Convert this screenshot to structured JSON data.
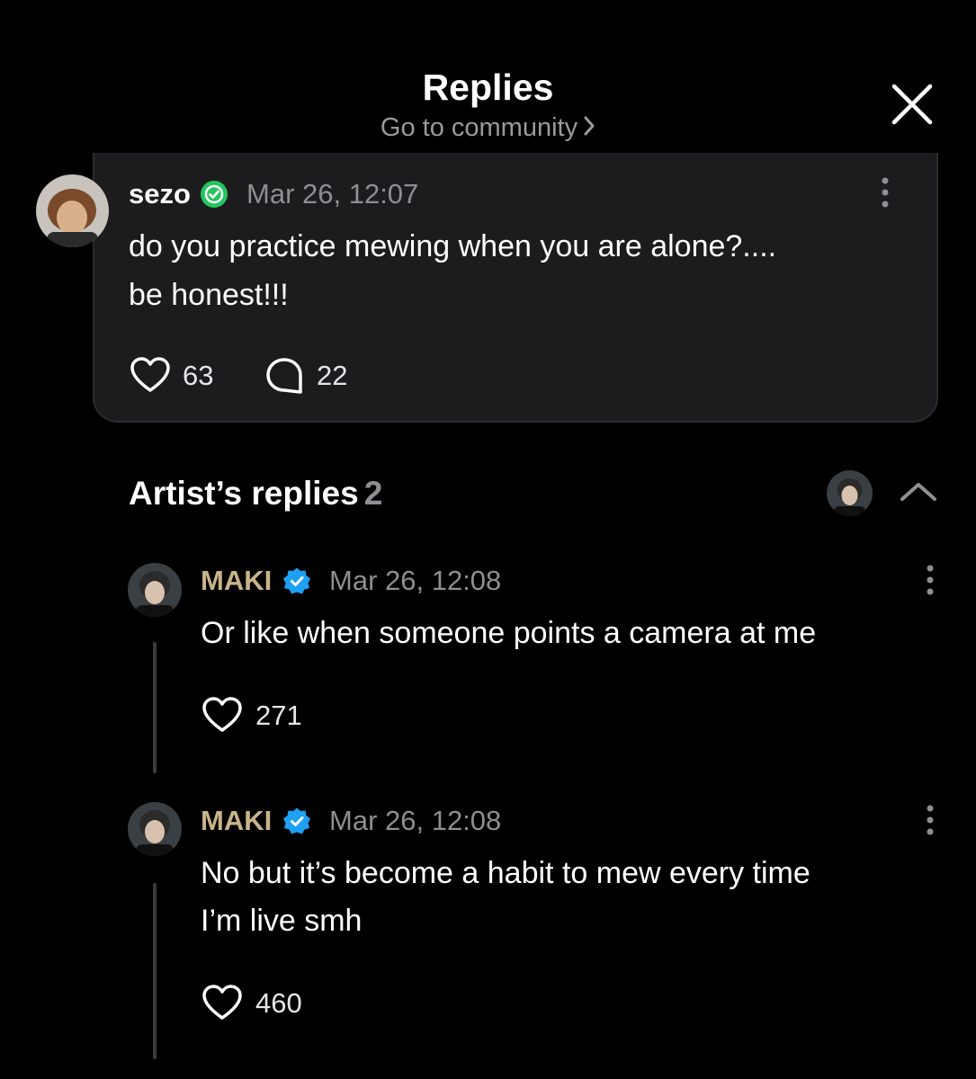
{
  "header": {
    "title": "Replies",
    "community_link": "Go to community"
  },
  "post": {
    "username": "sezo",
    "date": "Mar 26, 12:07",
    "text_line1": "do you practice mewing when you are alone?....",
    "text_line2": "be honest!!!",
    "likes": "63",
    "comments": "22"
  },
  "artist_replies": {
    "title": "Artist’s replies",
    "count": "2",
    "replies": [
      {
        "username": "MAKI",
        "date": "Mar 26, 12:08",
        "text_line1": "Or like when someone points a camera at me",
        "likes": "271"
      },
      {
        "username": "MAKI",
        "date": "Mar 26, 12:08",
        "text_line1": "No but it’s become a habit to mew every time",
        "text_line2": "I’m live smh",
        "likes": "460"
      }
    ]
  },
  "colors": {
    "background": "#000000",
    "card": "#1c1c1e",
    "artist_name": "#c9b48a",
    "verified_green": "#22c55e",
    "verified_blue": "#1da1f2",
    "muted": "#8e8e93"
  }
}
